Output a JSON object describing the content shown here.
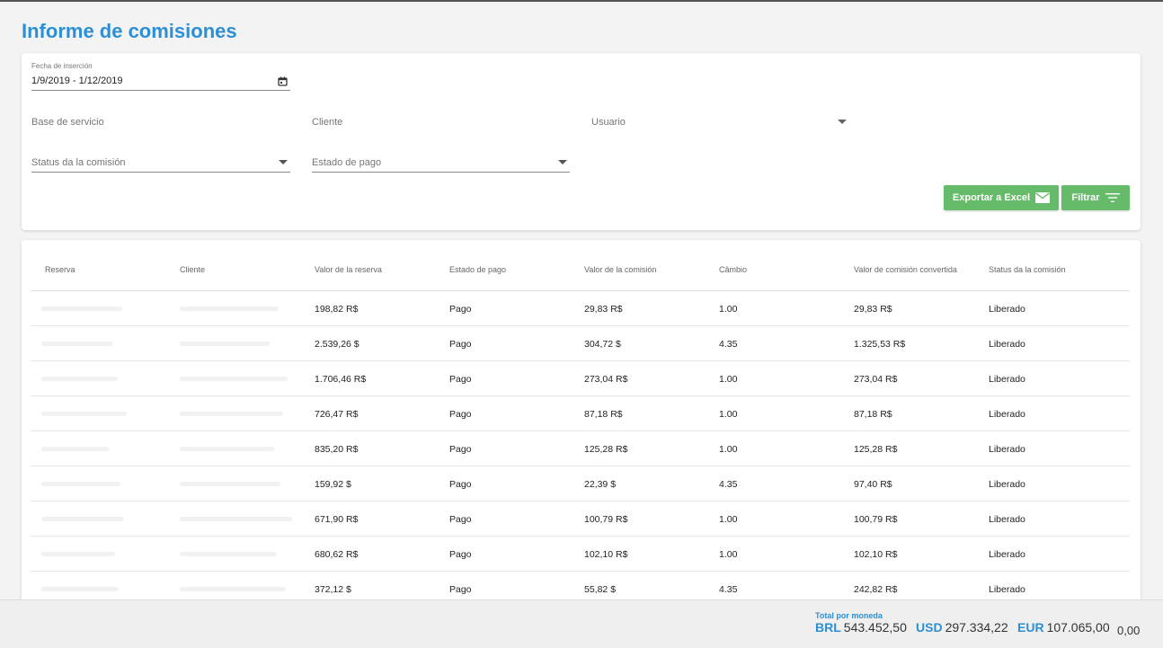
{
  "page": {
    "title": "Informe de comisiones"
  },
  "filters": {
    "date_label": "Fecha de inserción",
    "date_value": "1/9/2019 - 1/12/2019",
    "base_placeholder": "Base de servicio",
    "client_placeholder": "Cliente",
    "user_placeholder": "Usuario",
    "status_placeholder": "Status da la comisión",
    "payment_placeholder": "Estado de pago",
    "export_label": "Exportar a Excel",
    "filter_label": "Filtrar"
  },
  "table": {
    "columns": [
      "Reserva",
      "Cliente",
      "Valor de la reserva",
      "Estado de pago",
      "Valor de la comisión",
      "Câmbio",
      "Valor de comisión convertida",
      "Status da la comisión"
    ],
    "rows": [
      {
        "valor_reserva": "198,82 R$",
        "estado": "Pago",
        "valor_comision": "29,83 R$",
        "cambio": "1.00",
        "convertida": "29,83 R$",
        "status": "Liberado"
      },
      {
        "valor_reserva": "2.539,26 $",
        "estado": "Pago",
        "valor_comision": "304,72 $",
        "cambio": "4.35",
        "convertida": "1.325,53 R$",
        "status": "Liberado"
      },
      {
        "valor_reserva": "1.706,46 R$",
        "estado": "Pago",
        "valor_comision": "273,04 R$",
        "cambio": "1.00",
        "convertida": "273,04 R$",
        "status": "Liberado"
      },
      {
        "valor_reserva": "726,47 R$",
        "estado": "Pago",
        "valor_comision": "87,18 R$",
        "cambio": "1.00",
        "convertida": "87,18 R$",
        "status": "Liberado"
      },
      {
        "valor_reserva": "835,20 R$",
        "estado": "Pago",
        "valor_comision": "125,28 R$",
        "cambio": "1.00",
        "convertida": "125,28 R$",
        "status": "Liberado"
      },
      {
        "valor_reserva": "159,92 $",
        "estado": "Pago",
        "valor_comision": "22,39 $",
        "cambio": "4.35",
        "convertida": "97,40 R$",
        "status": "Liberado"
      },
      {
        "valor_reserva": "671,90 R$",
        "estado": "Pago",
        "valor_comision": "100,79 R$",
        "cambio": "1.00",
        "convertida": "100,79 R$",
        "status": "Liberado"
      },
      {
        "valor_reserva": "680,62 R$",
        "estado": "Pago",
        "valor_comision": "102,10 R$",
        "cambio": "1.00",
        "convertida": "102,10 R$",
        "status": "Liberado"
      },
      {
        "valor_reserva": "372,12 $",
        "estado": "Pago",
        "valor_comision": "55,82 $",
        "cambio": "4.35",
        "convertida": "242,82 R$",
        "status": "Liberado"
      }
    ]
  },
  "footer": {
    "total_label": "Total por moneda",
    "totals": [
      {
        "currency": "BRL",
        "amount": "543.452,50"
      },
      {
        "currency": "USD",
        "amount": "297.334,22"
      },
      {
        "currency": "EUR",
        "amount": "107.065,00"
      }
    ],
    "extra": "0,00"
  },
  "colors": {
    "accent": "#2d8fd3",
    "button": "#66bb6a"
  }
}
